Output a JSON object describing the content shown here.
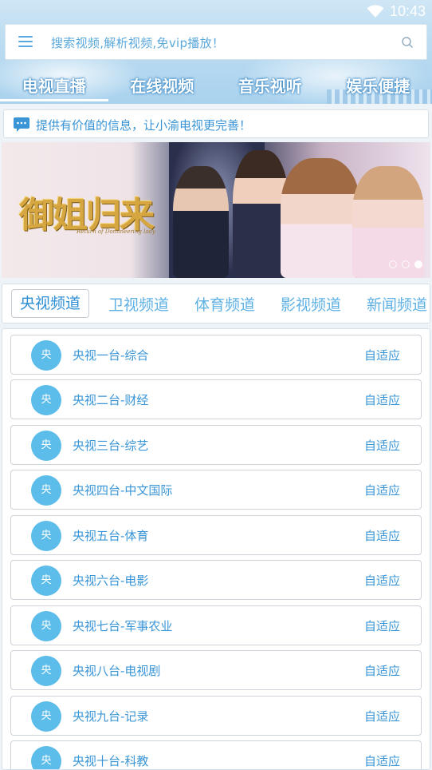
{
  "status_bar": {
    "time": "10:43"
  },
  "search": {
    "placeholder": "搜索视频,解析视频,免vip播放！"
  },
  "category_tabs": [
    {
      "label": "电视直播",
      "active": true
    },
    {
      "label": "在线视频",
      "active": false
    },
    {
      "label": "音乐视听",
      "active": false
    },
    {
      "label": "娱乐便捷",
      "active": false
    }
  ],
  "notice": {
    "text": "提供有价值的信息，让小渝电视更完善！"
  },
  "banner": {
    "title": "御姐归来",
    "subtitle": "Return of Domineering lady",
    "active_slide": 2,
    "slide_count": 3
  },
  "channel_tabs": [
    {
      "label": "央视频道",
      "active": true
    },
    {
      "label": "卫视频道",
      "active": false
    },
    {
      "label": "体育频道",
      "active": false
    },
    {
      "label": "影视频道",
      "active": false
    },
    {
      "label": "新闻频道",
      "active": false
    }
  ],
  "channels": [
    {
      "avatar": "央",
      "name": "央视一台-综合",
      "quality": "自适应"
    },
    {
      "avatar": "央",
      "name": "央视二台-财经",
      "quality": "自适应"
    },
    {
      "avatar": "央",
      "name": "央视三台-综艺",
      "quality": "自适应"
    },
    {
      "avatar": "央",
      "name": "央视四台-中文国际",
      "quality": "自适应"
    },
    {
      "avatar": "央",
      "name": "央视五台-体育",
      "quality": "自适应"
    },
    {
      "avatar": "央",
      "name": "央视六台-电影",
      "quality": "自适应"
    },
    {
      "avatar": "央",
      "name": "央视七台-军事农业",
      "quality": "自适应"
    },
    {
      "avatar": "央",
      "name": "央视八台-电视剧",
      "quality": "自适应"
    },
    {
      "avatar": "央",
      "name": "央视九台-记录",
      "quality": "自适应"
    },
    {
      "avatar": "央",
      "name": "央视十台-科教",
      "quality": "自适应"
    }
  ],
  "colors": {
    "accent": "#3a95d6",
    "avatar_bg": "#5cbcea",
    "header_bg": "#bcdcf1"
  },
  "icons": [
    "wifi-icon",
    "menu-icon",
    "search-icon",
    "chat-icon"
  ]
}
